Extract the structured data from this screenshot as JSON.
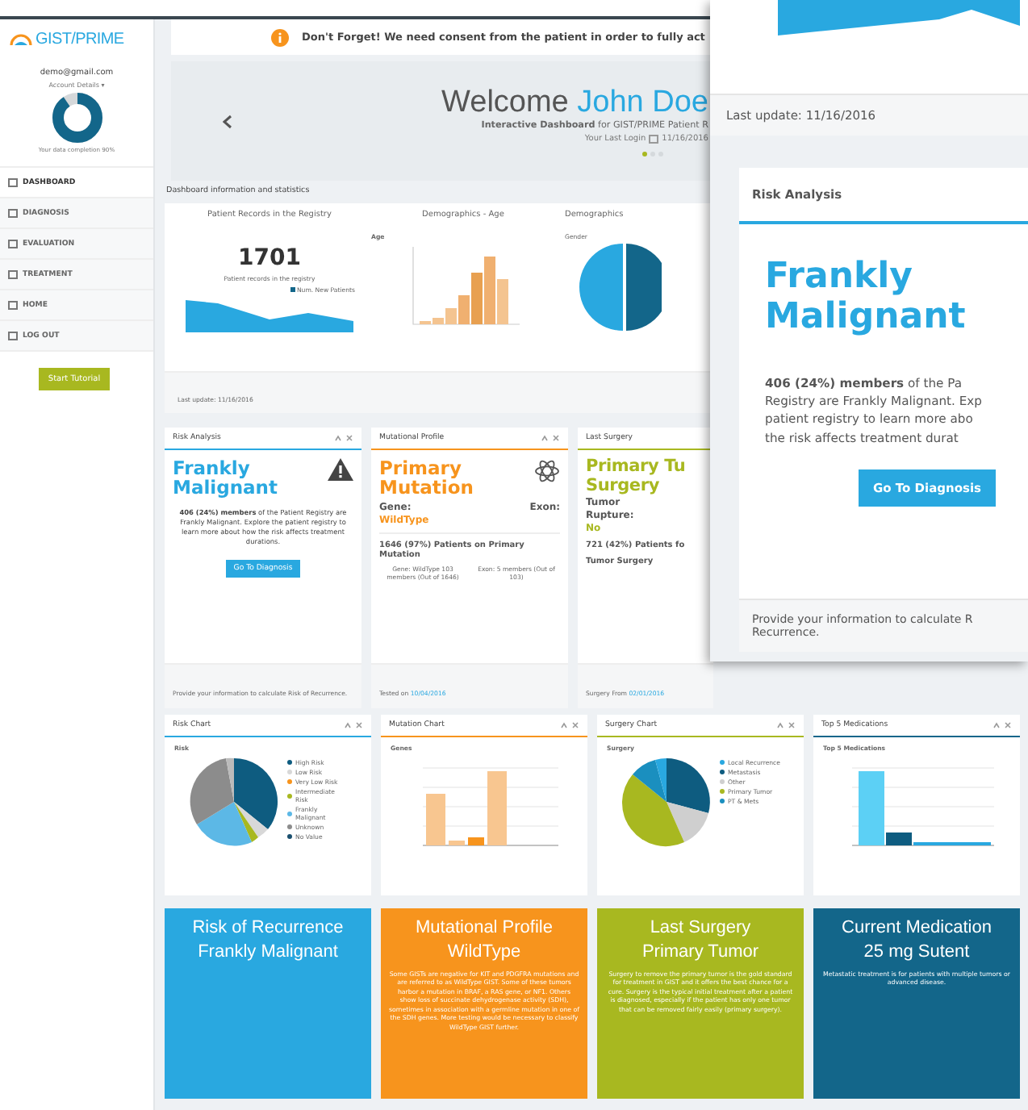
{
  "header": {
    "logo": "GIST/PRIME",
    "alert": "Don't Forget! We need consent from the patient in order to fully act"
  },
  "sidebar": {
    "email": "demo@gmail.com",
    "account": "Account Details ▾",
    "completion": {
      "level": 0.9,
      "label": "Your data completion 90%"
    },
    "items": [
      {
        "label": "DASHBOARD",
        "selected": true
      },
      {
        "label": "DIAGNOSIS",
        "selected": false
      },
      {
        "label": "EVALUATION",
        "selected": false
      },
      {
        "label": "TREATMENT",
        "selected": false
      },
      {
        "label": "HOME",
        "selected": false
      },
      {
        "label": "LOG OUT",
        "selected": false
      }
    ],
    "tutorial_button": "Start Tutorial"
  },
  "hero": {
    "greeting": "Welcome",
    "name": "John Doe",
    "subtitle": "**Interactive Dashboard** for GIST/PRIME Patient R",
    "last_login": "Your Last Login",
    "date": "11/16/2016",
    "dots": [
      {
        "selected": true
      },
      {
        "selected": false
      },
      {
        "selected": false
      }
    ]
  },
  "section_label": "Dashboard information and statistics",
  "stats": {
    "records_title": "Patient Records in the Registry",
    "count": "1701",
    "count_caption": "Patient records in the registry",
    "legend": "Num. New Patients",
    "age_title": "Demographics - Age",
    "age_axis": "Age",
    "gender_title": "Demographics",
    "gender_axis": "Gender",
    "footer": "Last update: 11/16/2016"
  },
  "widgets": [
    {
      "kind": "risk",
      "title": "Risk Analysis",
      "heading": "Frankly Malignant",
      "text": "**406 (24%) members** of the Patient Registry are Frankly Malignant. Explore the patient registry to learn more about how the risk affects treatment durations.",
      "button": "Go To Diagnosis",
      "footer": "Provide your information to calculate Risk of Recurrence."
    },
    {
      "kind": "mutation",
      "title": "Mutational Profile",
      "heading": "Primary Mutation",
      "gene_label": "Gene:",
      "exon_label": "Exon:",
      "gene_value": "WildType",
      "summary": "1646 (97%) Patients on Primary Mutation",
      "gene_detail": "Gene: WildType 103 members (Out of 1646)",
      "exon_detail": "Exon: 5 members (Out of 103)",
      "footer_label": "Tested on",
      "footer_date": "10/04/2016"
    },
    {
      "kind": "surgery",
      "title": "Last Surgery",
      "heading": "Primary Tu",
      "heading_2": "Surgery",
      "field_1": "Tumor",
      "field_2": "Rupture:",
      "value": "No",
      "summary": "721 (42%) Patients fo",
      "summary_2": "Tumor Surgery",
      "footer_label": "Surgery From",
      "footer_date": "02/01/2016"
    }
  ],
  "charts": [
    {
      "kind": "pie",
      "title": "Risk Chart",
      "axis": "Risk",
      "legend": [
        {
          "label": "High Risk",
          "color": "#0e5c80"
        },
        {
          "label": "Low Risk",
          "color": "#d8d8d8"
        },
        {
          "label": "Very Low Risk",
          "color": "#f7941d"
        },
        {
          "label": "Intermediate Risk",
          "color": "#a8b820"
        },
        {
          "label": "Frankly Malignant",
          "color": "#5cb8e6"
        },
        {
          "label": "Unknown",
          "color": "#8c8c8c"
        },
        {
          "label": "No Value",
          "color": "#1a4f6e"
        }
      ]
    },
    {
      "kind": "bars",
      "title": "Mutation Chart",
      "axis": "Genes"
    },
    {
      "kind": "pie2",
      "title": "Surgery Chart",
      "axis": "Surgery",
      "legend": [
        {
          "label": "Local Recurrence",
          "color": "#29a8e0"
        },
        {
          "label": "Metastasis",
          "color": "#0e5c80"
        },
        {
          "label": "Other",
          "color": "#cfcfcf"
        },
        {
          "label": "Primary Tumor",
          "color": "#a8b820"
        },
        {
          "label": "PT & Mets",
          "color": "#1a8fbf"
        }
      ]
    },
    {
      "kind": "meds",
      "title": "Top 5 Medications",
      "axis": "Top 5 Medications"
    }
  ],
  "tiles": [
    {
      "color": "#29a8e0",
      "title": "Risk of Recurrence",
      "value": "Frankly Malignant"
    },
    {
      "color": "#f7941d",
      "title": "Mutational Profile",
      "value": "WildType",
      "text": "Some GISTs are negative for KIT and PDGFRA mutations and are referred to as WildType GIST. Some of these tumors harbor a mutation in BRAF, a RAS gene, or NF1. Others show loss of succinate dehydrogenase activity (SDH), sometimes in association with a germline mutation in one of the SDH genes. More testing would be necessary to classify WildType GIST further."
    },
    {
      "color": "#a8b820",
      "title": "Last Surgery",
      "value": "Primary Tumor",
      "text": "Surgery to remove the primary tumor is the gold standard for treatment in GIST and it offers the best chance for a cure. Surgery is the typical initial treatment after a patient is diagnosed, especially if the patient has only one tumor that can be removed fairly easily (primary surgery)."
    },
    {
      "color": "#13668a",
      "title": "Current Medication",
      "value": "25 mg Sutent",
      "text": "Metastatic treatment is for patients with multiple tumors or advanced disease."
    }
  ],
  "callout": {
    "footer": "Last update: 11/16/2016",
    "title": "Risk Analysis",
    "heading": "Frankly Malignant",
    "lines": [
      "**406 (24%) members** of the Pa",
      "Registry are Frankly Malignant. Exp",
      "patient registry to learn more abo",
      "the risk affects treatment durat"
    ],
    "button": "Go To Diagnosis",
    "footer_lines": [
      "Provide your information to calculate R",
      "Recurrence."
    ]
  }
}
